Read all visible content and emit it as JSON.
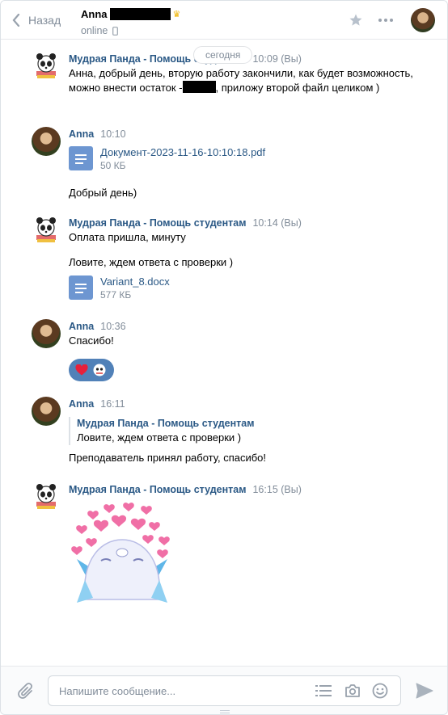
{
  "header": {
    "back_label": "Назад",
    "peer_name": "Anna",
    "peer_status": "online",
    "date_separator": "сегодня"
  },
  "messages": [
    {
      "author": "Мудрая Панда - Помощь студентам",
      "time": "10:09 (Вы)",
      "text_1": "Анна, добрый день, вторую работу закончили, как будет возможность, можно внести остаток -",
      "text_2": ", приложу второй файл целиком )"
    },
    {
      "author": "Anna",
      "time": "10:10",
      "doc_name": "Документ-2023-11-16-10:10:18.pdf",
      "doc_size": "50 КБ",
      "text": "Добрый день)"
    },
    {
      "author": "Мудрая Панда - Помощь студентам",
      "time": "10:14 (Вы)",
      "text_1": "Оплата пришла, минуту",
      "text_2": "Ловите, ждем ответа с проверки )",
      "doc_name": "Variant_8.docx",
      "doc_size": "577 КБ"
    },
    {
      "author": "Anna",
      "time": "10:36",
      "text": "Спасибо!"
    },
    {
      "author": "Anna",
      "time": "16:11",
      "reply_author": "Мудрая Панда - Помощь студентам",
      "reply_text": "Ловите, ждем ответа с проверки )",
      "text": "Преподаватель принял работу, спасибо!"
    },
    {
      "author": "Мудрая Панда - Помощь студентам",
      "time": "16:15 (Вы)"
    }
  ],
  "composer": {
    "placeholder": "Напишите сообщение..."
  },
  "colors": {
    "link": "#2a5885",
    "muted": "#818c99",
    "doc_icon": "#6d96d1",
    "reaction": "#5181b8"
  }
}
